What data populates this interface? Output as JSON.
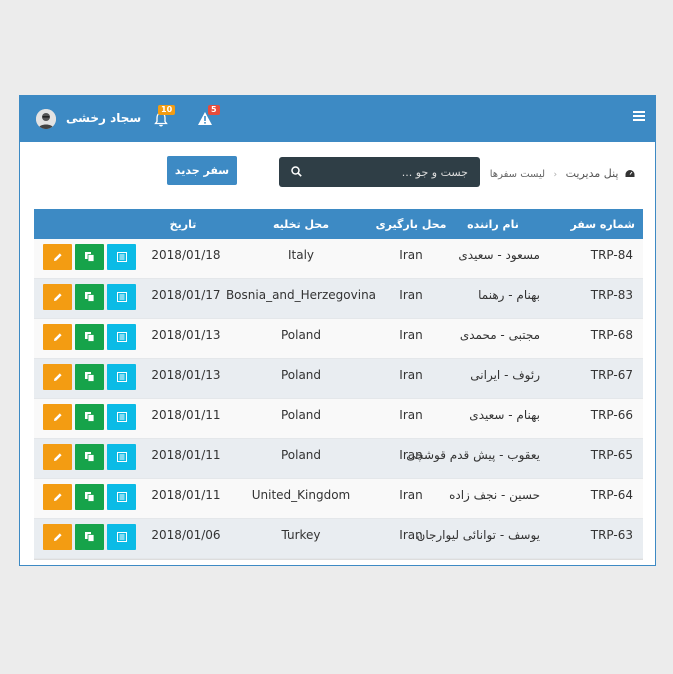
{
  "header": {
    "user_name": "سجاد رخشی",
    "alert_count": "5",
    "notification_count": "10"
  },
  "breadcrumb": {
    "home": "پنل مدیریت",
    "current": "لیست سفرها"
  },
  "search": {
    "placeholder": "جست و جو ..."
  },
  "toolbar": {
    "new_trip_label": "سفر جدید"
  },
  "table": {
    "columns": {
      "trip_no": "شماره سفر",
      "driver": "نام راننده",
      "load_place": "محل بارگیری",
      "unload_place": "محل تخلیه",
      "date": "تاریخ"
    },
    "rows": [
      {
        "trip_no": "TRP-84",
        "driver": "مسعود - سعیدی",
        "load_place": "Iran",
        "unload_place": "Italy",
        "date": "2018/01/18"
      },
      {
        "trip_no": "TRP-83",
        "driver": "بهنام - رهنما",
        "load_place": "Iran",
        "unload_place": "Bosnia_and_Herzegovina",
        "date": "2018/01/17"
      },
      {
        "trip_no": "TRP-68",
        "driver": "مجتبی - محمدی",
        "load_place": "Iran",
        "unload_place": "Poland",
        "date": "2018/01/13"
      },
      {
        "trip_no": "TRP-67",
        "driver": "رئوف - ایرانی",
        "load_place": "Iran",
        "unload_place": "Poland",
        "date": "2018/01/13"
      },
      {
        "trip_no": "TRP-66",
        "driver": "بهنام - سعیدی",
        "load_place": "Iran",
        "unload_place": "Poland",
        "date": "2018/01/11"
      },
      {
        "trip_no": "TRP-65",
        "driver": "یعقوب - پیش قدم قوشچی",
        "load_place": "Iran",
        "unload_place": "Poland",
        "date": "2018/01/11"
      },
      {
        "trip_no": "TRP-64",
        "driver": "حسین - نجف زاده",
        "load_place": "Iran",
        "unload_place": "United_Kingdom",
        "date": "2018/01/11"
      },
      {
        "trip_no": "TRP-63",
        "driver": "یوسف - توانائی لیوارجان",
        "load_place": "Iran",
        "unload_place": "Turkey",
        "date": "2018/01/06"
      }
    ]
  },
  "colors": {
    "primary": "#3d8ac4",
    "search_bg": "#2f3e46",
    "edit": "#f39c12",
    "copy": "#16a34a",
    "view": "#0bbbe6"
  },
  "icons": {
    "menu": "menu-icon",
    "alert": "warning-icon",
    "bell": "bell-icon",
    "dashboard": "dashboard-icon",
    "search": "search-icon",
    "edit": "pencil-icon",
    "copy": "copy-icon",
    "view": "list-icon"
  }
}
